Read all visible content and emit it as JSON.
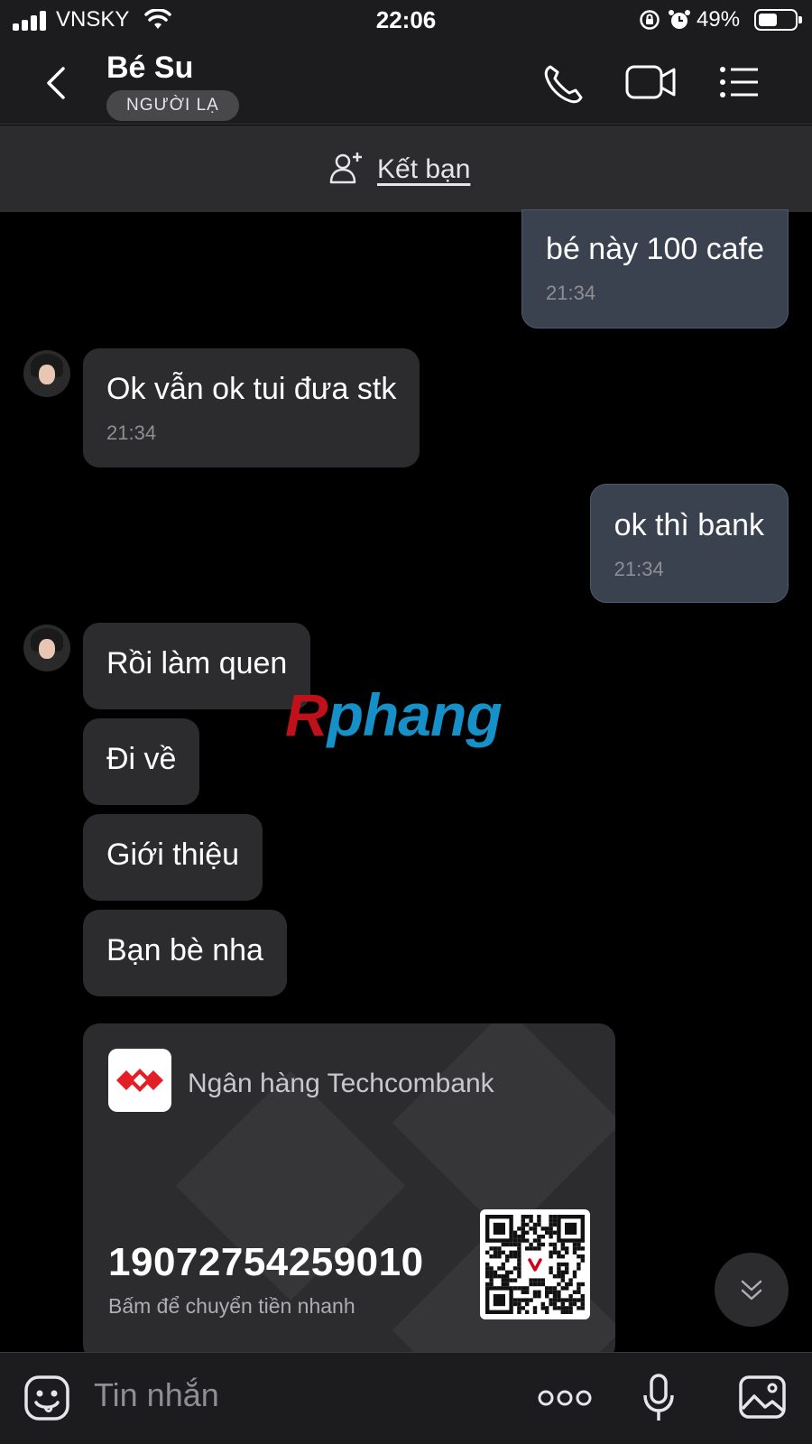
{
  "status_bar": {
    "carrier": "VNSKY",
    "time": "22:06",
    "battery_percent": "49%"
  },
  "header": {
    "contact_name": "Bé Su",
    "badge": "NGƯỜI LẠ"
  },
  "add_friend": {
    "label": "Kết bạn"
  },
  "messages": [
    {
      "direction": "out",
      "text": "bé này 100 cafe",
      "time": "21:34"
    },
    {
      "direction": "in",
      "text": "Ok vẫn ok tui đưa stk",
      "time": "21:34"
    },
    {
      "direction": "out",
      "text": "ok thì bank",
      "time": "21:34"
    },
    {
      "direction": "in",
      "text": "Rồi làm quen"
    },
    {
      "direction": "in",
      "text": "Đi về"
    },
    {
      "direction": "in",
      "text": "Giới thiệu"
    },
    {
      "direction": "in",
      "text": "Bạn bè nha"
    }
  ],
  "watermark": {
    "first": "R",
    "rest": "phang"
  },
  "bank_card": {
    "bank_name": "Ngân hàng Techcombank",
    "account_number": "19072754259010",
    "hint": "Bấm để chuyển tiền nhanh"
  },
  "composer": {
    "placeholder": "Tin nhắn"
  },
  "colors": {
    "outgoing_bubble": "#3a4250",
    "incoming_bubble": "#2c2c2e",
    "techcombank_red": "#e41e26"
  }
}
